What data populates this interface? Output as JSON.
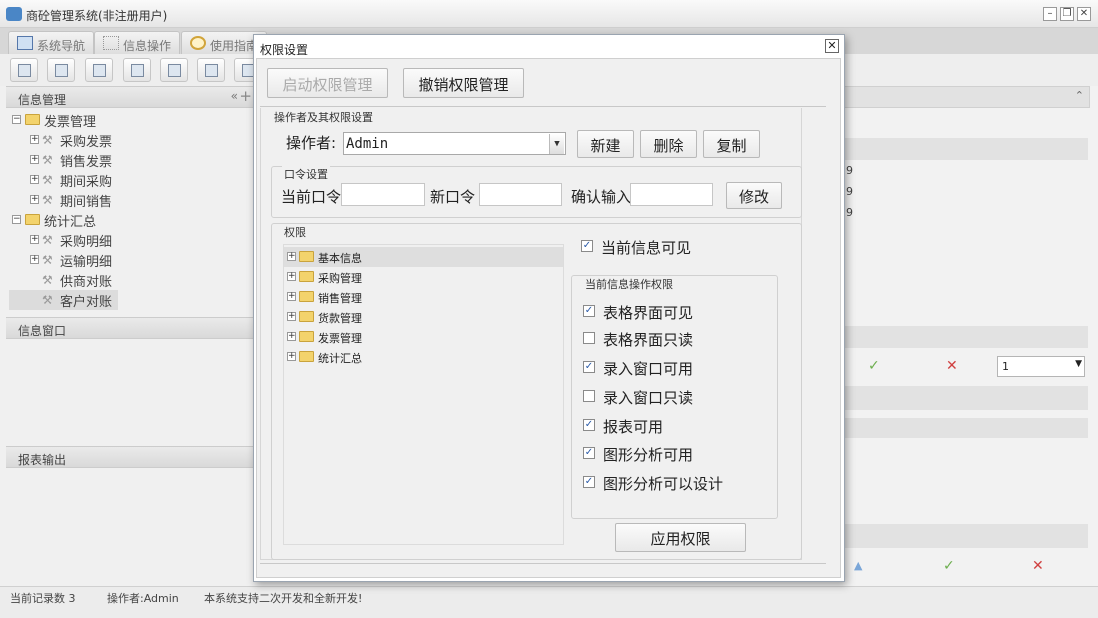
{
  "app": {
    "title": "商砼管理系统(非注册用户)",
    "window_buttons": [
      "minimize-icon",
      "restore-icon",
      "close-icon"
    ]
  },
  "tabs": [
    {
      "label": "系统导航",
      "icon": "monitor-icon"
    },
    {
      "label": "信息操作",
      "icon": "grid-icon"
    },
    {
      "label": "使用指南",
      "icon": "clock-icon"
    }
  ],
  "left": {
    "info_header": "信息管理",
    "tree": [
      {
        "label": "发票管理",
        "type": "folder",
        "expander": "-"
      },
      {
        "label": "采购发票",
        "type": "leaf",
        "expander": "+"
      },
      {
        "label": "销售发票",
        "type": "leaf",
        "expander": "+"
      },
      {
        "label": "期间采购",
        "type": "leaf",
        "expander": "+"
      },
      {
        "label": "期间销售",
        "type": "leaf",
        "expander": "+"
      },
      {
        "label": "统计汇总",
        "type": "folder",
        "expander": "-"
      },
      {
        "label": "采购明细",
        "type": "leaf",
        "expander": "+"
      },
      {
        "label": "运输明细",
        "type": "leaf",
        "expander": "+"
      },
      {
        "label": "供商对账",
        "type": "leaf",
        "expander": ""
      },
      {
        "label": "客户对账",
        "type": "leaf",
        "expander": "",
        "selected": true
      }
    ],
    "window_header": "信息窗口",
    "report_header": "报表输出"
  },
  "background_right": {
    "cells": [
      "9",
      "9",
      "9"
    ],
    "page_value": "1"
  },
  "status": {
    "records": "当前记录数 3",
    "operator": "操作者:Admin",
    "message": "本系统支持二次开发和全新开发!"
  },
  "dialog": {
    "title": "权限设置",
    "start_btn": "启动权限管理",
    "revoke_btn": "撤销权限管理",
    "operator_group": "操作者及其权限设置",
    "operator_label": "操作者:",
    "operator_value": "Admin",
    "new_btn": "新建",
    "delete_btn": "删除",
    "copy_btn": "复制",
    "password_group": "口令设置",
    "current_pw_label": "当前口令",
    "new_pw_label": "新口令",
    "confirm_label": "确认输入",
    "modify_btn": "修改",
    "perm_group": "权限",
    "perm_tree": [
      "基本信息",
      "采购管理",
      "销售管理",
      "货款管理",
      "发票管理",
      "统计汇总"
    ],
    "visible_label": "当前信息可见",
    "visible_checked": true,
    "ops_group": "当前信息操作权限",
    "ops": [
      {
        "label": "表格界面可见",
        "checked": true
      },
      {
        "label": "表格界面只读",
        "checked": false
      },
      {
        "label": "录入窗口可用",
        "checked": true
      },
      {
        "label": "录入窗口只读",
        "checked": false
      },
      {
        "label": "报表可用",
        "checked": true
      },
      {
        "label": "图形分析可用",
        "checked": true
      },
      {
        "label": "图形分析可以设计",
        "checked": true
      }
    ],
    "apply_btn": "应用权限"
  }
}
